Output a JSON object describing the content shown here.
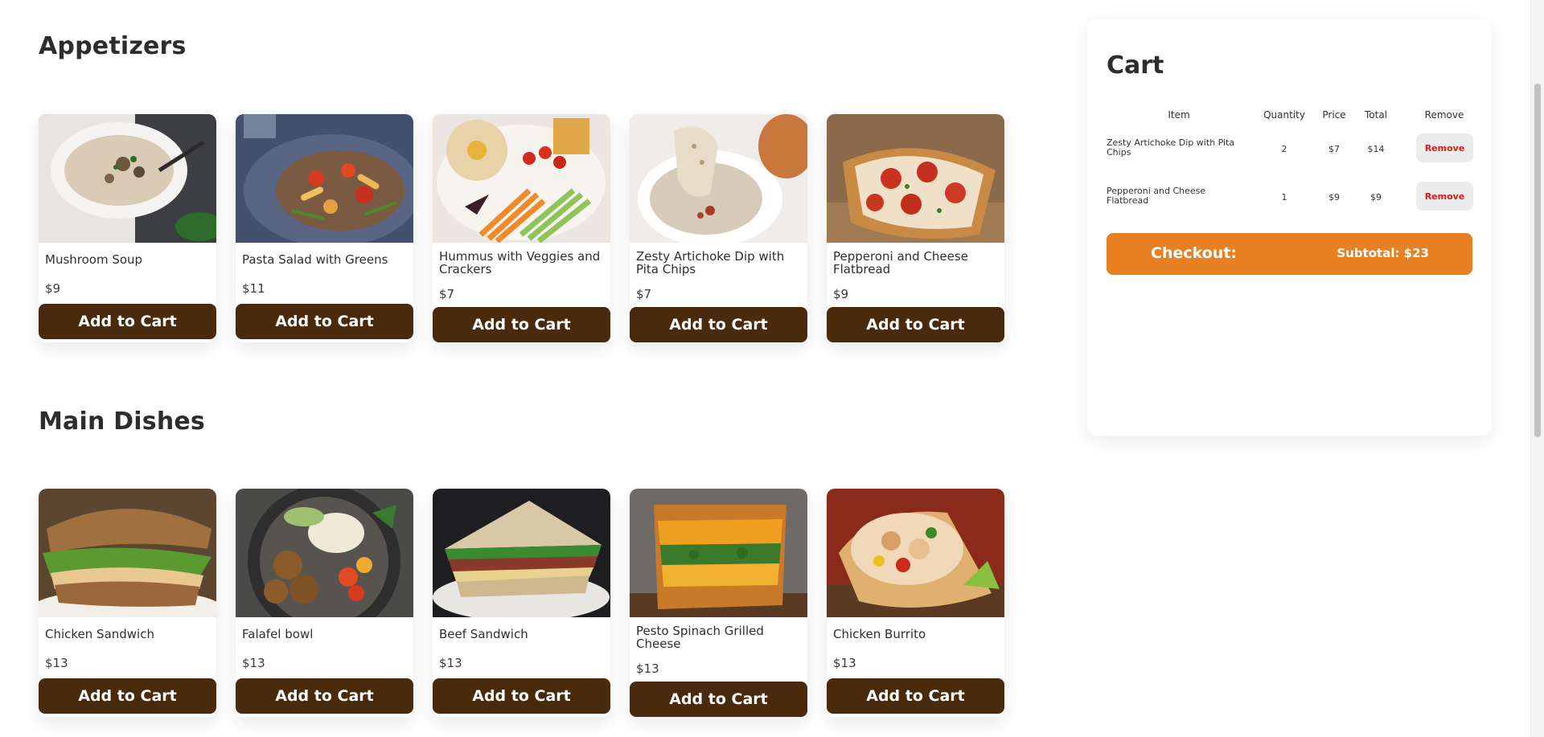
{
  "sections": [
    {
      "title": "Appetizers",
      "items": [
        {
          "name": "Mushroom Soup",
          "price": "$9",
          "button": "Add to Cart",
          "image": "mushroom-soup-photo"
        },
        {
          "name": "Pasta Salad with Greens",
          "price": "$11",
          "button": "Add to Cart",
          "image": "pasta-salad-photo"
        },
        {
          "name": "Hummus with Veggies and Crackers",
          "price": "$7",
          "button": "Add to Cart",
          "image": "hummus-platter-photo"
        },
        {
          "name": "Zesty Artichoke Dip with Pita Chips",
          "price": "$7",
          "button": "Add to Cart",
          "image": "artichoke-dip-photo"
        },
        {
          "name": "Pepperoni and Cheese Flatbread",
          "price": "$9",
          "button": "Add to Cart",
          "image": "flatbread-photo"
        }
      ]
    },
    {
      "title": "Main Dishes",
      "items": [
        {
          "name": "Chicken Sandwich",
          "price": "$13",
          "button": "Add to Cart",
          "image": "chicken-sandwich-photo"
        },
        {
          "name": "Falafel bowl",
          "price": "$13",
          "button": "Add to Cart",
          "image": "falafel-bowl-photo"
        },
        {
          "name": "Beef Sandwich",
          "price": "$13",
          "button": "Add to Cart",
          "image": "beef-sandwich-photo"
        },
        {
          "name": "Pesto Spinach Grilled Cheese",
          "price": "$13",
          "button": "Add to Cart",
          "image": "grilled-cheese-photo"
        },
        {
          "name": "Chicken Burrito",
          "price": "$13",
          "button": "Add to Cart",
          "image": "burrito-photo"
        }
      ]
    }
  ],
  "cart": {
    "title": "Cart",
    "headers": {
      "item": "Item",
      "quantity": "Quantity",
      "price": "Price",
      "total": "Total",
      "remove": "Remove"
    },
    "rows": [
      {
        "item": "Zesty Artichoke Dip with Pita Chips",
        "quantity": "2",
        "price": "$7",
        "total": "$14",
        "remove": "Remove"
      },
      {
        "item": "Pepperoni and Cheese Flatbread",
        "quantity": "1",
        "price": "$9",
        "total": "$9",
        "remove": "Remove"
      }
    ],
    "checkout_label": "Checkout:",
    "subtotal_label": "Subtotal: $23"
  },
  "colors": {
    "button_brown": "#4a2a0c",
    "checkout_orange": "#e78023",
    "remove_red": "#e01818"
  }
}
